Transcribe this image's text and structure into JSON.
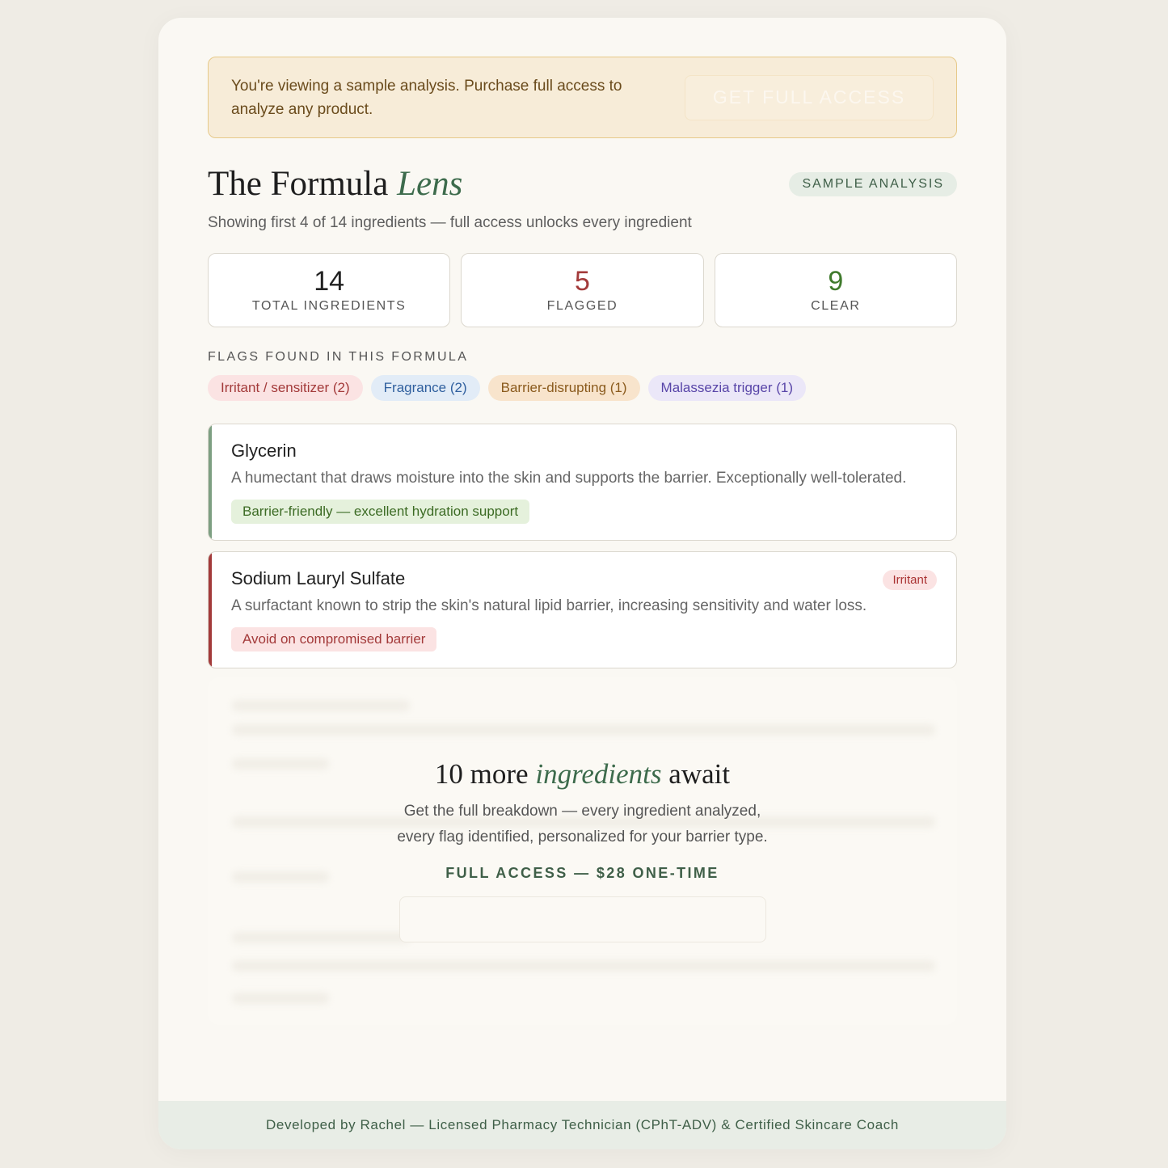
{
  "notice": {
    "text": "You're viewing a sample analysis. Purchase full access to analyze any product.",
    "button_label": "GET FULL ACCESS"
  },
  "header": {
    "title_main": "The Formula ",
    "title_emph": "Lens",
    "badge": "SAMPLE ANALYSIS",
    "subtitle": "Showing first 4 of 14 ingredients — full access unlocks every ingredient"
  },
  "stats": [
    {
      "value": "14",
      "label": "TOTAL INGREDIENTS",
      "color": "#222222"
    },
    {
      "value": "5",
      "label": "FLAGGED",
      "color": "#a33a3a"
    },
    {
      "value": "9",
      "label": "CLEAR",
      "color": "#3f7a2c"
    }
  ],
  "flags": {
    "heading": "FLAGS FOUND IN THIS FORMULA",
    "chips": [
      {
        "label": "Irritant / sensitizer (2)",
        "bg": "#fbe3e3",
        "fg": "#a33a3a"
      },
      {
        "label": "Fragrance (2)",
        "bg": "#e2ecf7",
        "fg": "#2f5f9e"
      },
      {
        "label": "Barrier-disrupting (1)",
        "bg": "#f8e4cc",
        "fg": "#8a5a1c"
      },
      {
        "label": "Malassezia trigger (1)",
        "bg": "#ebe7f8",
        "fg": "#5845a8"
      }
    ]
  },
  "ingredients": [
    {
      "name": "Glycerin",
      "desc": "A humectant that draws moisture into the skin and supports the barrier. Exceptionally well-tolerated.",
      "tag": "Barrier-friendly — excellent hydration support",
      "bar": "#7d9f82",
      "tag_bg": "#e5f1dc",
      "tag_fg": "#3c6b24"
    },
    {
      "name": "Sodium Lauryl Sulfate",
      "flag": "Irritant",
      "desc": "A surfactant known to strip the skin's natural lipid barrier, increasing sensitivity and water loss.",
      "tag": "Avoid on compromised barrier",
      "bar": "#a33a3a",
      "tag_bg": "#fbe3e3",
      "tag_fg": "#a33a3a"
    }
  ],
  "locked": {
    "title_a": "10 more ",
    "title_emph": "ingredients",
    "title_b": " await",
    "desc_1": "Get the full breakdown — every ingredient analyzed,",
    "desc_2": "every flag identified, personalized for your barrier type.",
    "price": "FULL ACCESS — $28 ONE-TIME"
  },
  "footer": {
    "text": "Developed by Rachel — Licensed Pharmacy Technician (CPhT-ADV) & Certified Skincare Coach"
  }
}
